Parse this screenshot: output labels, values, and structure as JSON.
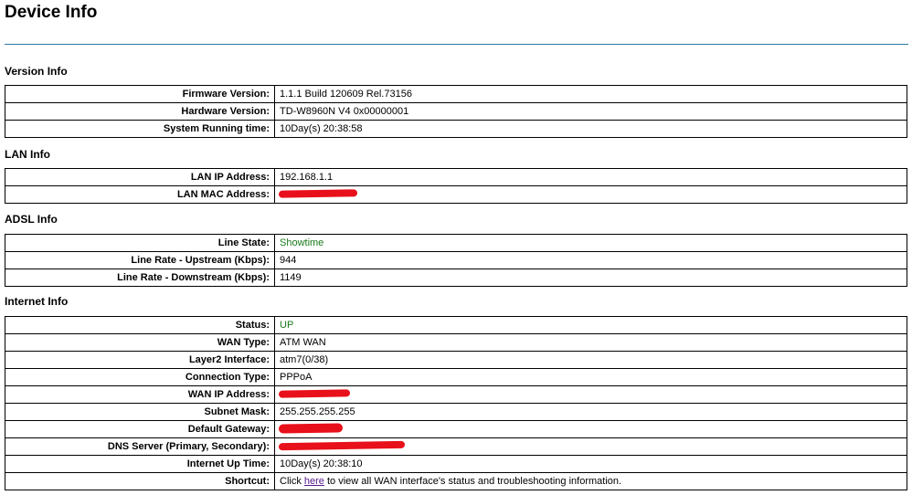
{
  "page": {
    "title": "Device Info"
  },
  "sections": {
    "version": {
      "title": "Version Info",
      "rows": [
        {
          "label": "Firmware Version:",
          "value": "1.1.1 Build 120609 Rel.73156"
        },
        {
          "label": "Hardware Version:",
          "value": "TD-W8960N V4 0x00000001"
        },
        {
          "label": "System Running time:",
          "value": "10Day(s) 20:38:58"
        }
      ]
    },
    "lan": {
      "title": "LAN Info",
      "rows": [
        {
          "label": "LAN IP Address:",
          "value": "192.168.1.1"
        },
        {
          "label": "LAN MAC Address:",
          "value": ""
        }
      ]
    },
    "adsl": {
      "title": "ADSL Info",
      "rows": [
        {
          "label": "Line State:",
          "value": "Showtime"
        },
        {
          "label": "Line Rate - Upstream (Kbps):",
          "value": "944"
        },
        {
          "label": "Line Rate - Downstream (Kbps):",
          "value": "1149"
        }
      ]
    },
    "internet": {
      "title": "Internet Info",
      "rows": [
        {
          "label": "Status:",
          "value": "UP"
        },
        {
          "label": "WAN Type:",
          "value": "ATM WAN"
        },
        {
          "label": "Layer2 Interface:",
          "value": "atm7(0/38)"
        },
        {
          "label": "Connection Type:",
          "value": "PPPoA"
        },
        {
          "label": "WAN IP Address:",
          "value": ""
        },
        {
          "label": "Subnet Mask:",
          "value": "255.255.255.255"
        },
        {
          "label": "Default Gateway:",
          "value": ""
        },
        {
          "label": "DNS Server (Primary, Secondary):",
          "value": ""
        },
        {
          "label": "Internet Up Time:",
          "value": "10Day(s) 20:38:10"
        },
        {
          "label": "Shortcut:",
          "value": ""
        }
      ],
      "shortcut": {
        "prefix": "Click ",
        "link_text": "here",
        "suffix": " to view all WAN interface's status and troubleshooting information."
      }
    }
  },
  "colors": {
    "status_green": "#1a7a1a",
    "redaction": "#e8101a",
    "title_rule": "#2a7aa3",
    "link": "#551a8b"
  }
}
